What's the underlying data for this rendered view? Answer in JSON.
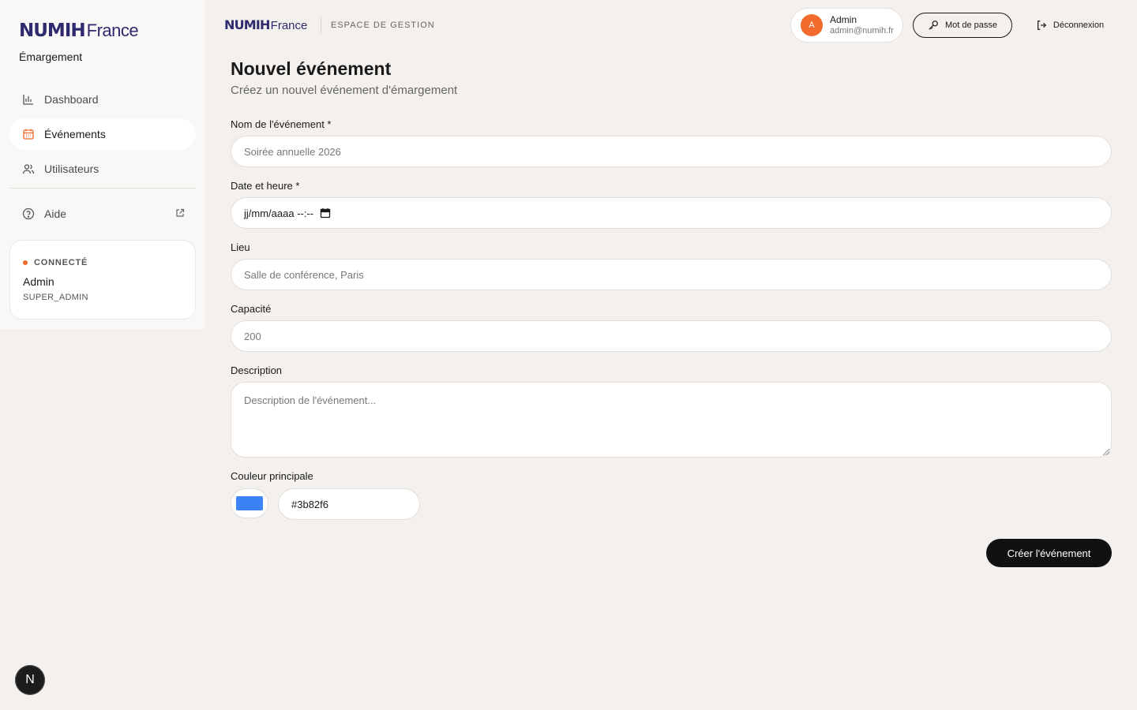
{
  "brand": {
    "name": "NUMIH",
    "country": "France",
    "app_name": "Émargement"
  },
  "topbar": {
    "brand": "NUMIH",
    "country": "France",
    "section_label": "ESPACE DE GESTION",
    "user": {
      "initial": "A",
      "name": "Admin",
      "email": "admin@numih.fr"
    },
    "password_button": "Mot de passe",
    "logout_button": "Déconnexion"
  },
  "sidebar": {
    "items": [
      {
        "label": "Dashboard",
        "icon": "bar-chart-icon",
        "active": false
      },
      {
        "label": "Événements",
        "icon": "calendar-icon",
        "active": true
      },
      {
        "label": "Utilisateurs",
        "icon": "users-icon",
        "active": false
      }
    ],
    "help": {
      "label": "Aide",
      "icon": "help-circle-icon",
      "external_icon": "external-link-icon"
    },
    "status": {
      "label": "CONNECTÉ",
      "name": "Admin",
      "role": "SUPER_ADMIN"
    },
    "badge": "N"
  },
  "main": {
    "title": "Nouvel événement",
    "subtitle": "Créez un nouvel événement d'émargement",
    "form": {
      "name": {
        "label": "Nom de l'événement *",
        "placeholder": "Soirée annuelle 2026",
        "value": ""
      },
      "datetime": {
        "label": "Date et heure *",
        "placeholder": "jj/mm/aaaa --:--",
        "value": ""
      },
      "location": {
        "label": "Lieu",
        "placeholder": "Salle de conférence, Paris",
        "value": ""
      },
      "capacity": {
        "label": "Capacité",
        "placeholder": "200",
        "value": ""
      },
      "description": {
        "label": "Description",
        "placeholder": "Description de l'événement...",
        "value": ""
      },
      "color": {
        "label": "Couleur principale",
        "value": "#3b82f6"
      }
    },
    "submit_label": "Créer l'événement"
  },
  "colors": {
    "accent": "#f26b2c",
    "brand": "#2e2a6e",
    "primary_button": "#111111",
    "event_color": "#3b82f6"
  }
}
